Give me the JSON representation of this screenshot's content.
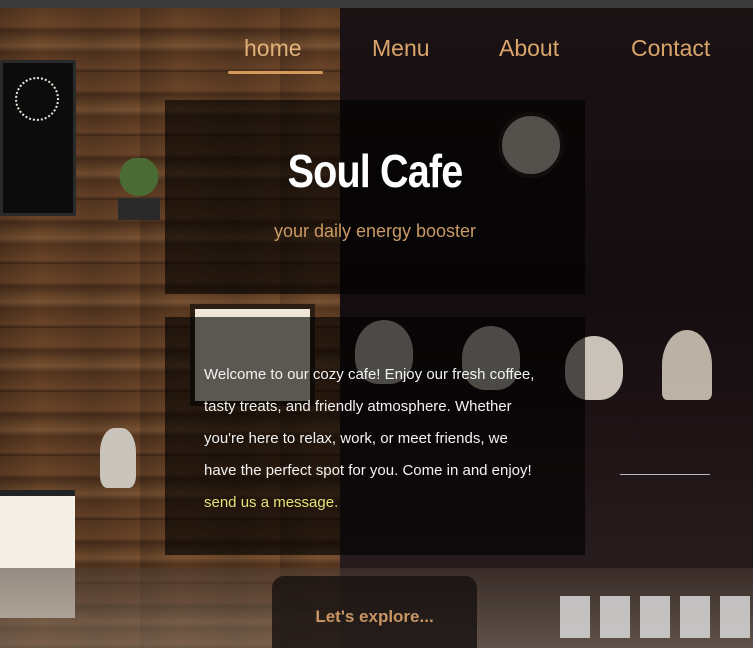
{
  "nav": {
    "items": [
      {
        "label": "home"
      },
      {
        "label": "Menu"
      },
      {
        "label": "About"
      },
      {
        "label": "Contact"
      }
    ]
  },
  "hero": {
    "title": "Soul Cafe",
    "tagline": "your daily energy booster"
  },
  "welcome": {
    "text": "Welcome to our cozy cafe! Enjoy our fresh coffee, tasty treats, and friendly atmosphere. Whether you're here to relax, work, or meet friends, we have the perfect spot for you. Come in and enjoy!",
    "link_label": "send us a message."
  },
  "cta": {
    "label": "Let's explore..."
  },
  "colors": {
    "accent": "#d9a56b",
    "link": "#e8e07a",
    "panel": "#000000"
  }
}
